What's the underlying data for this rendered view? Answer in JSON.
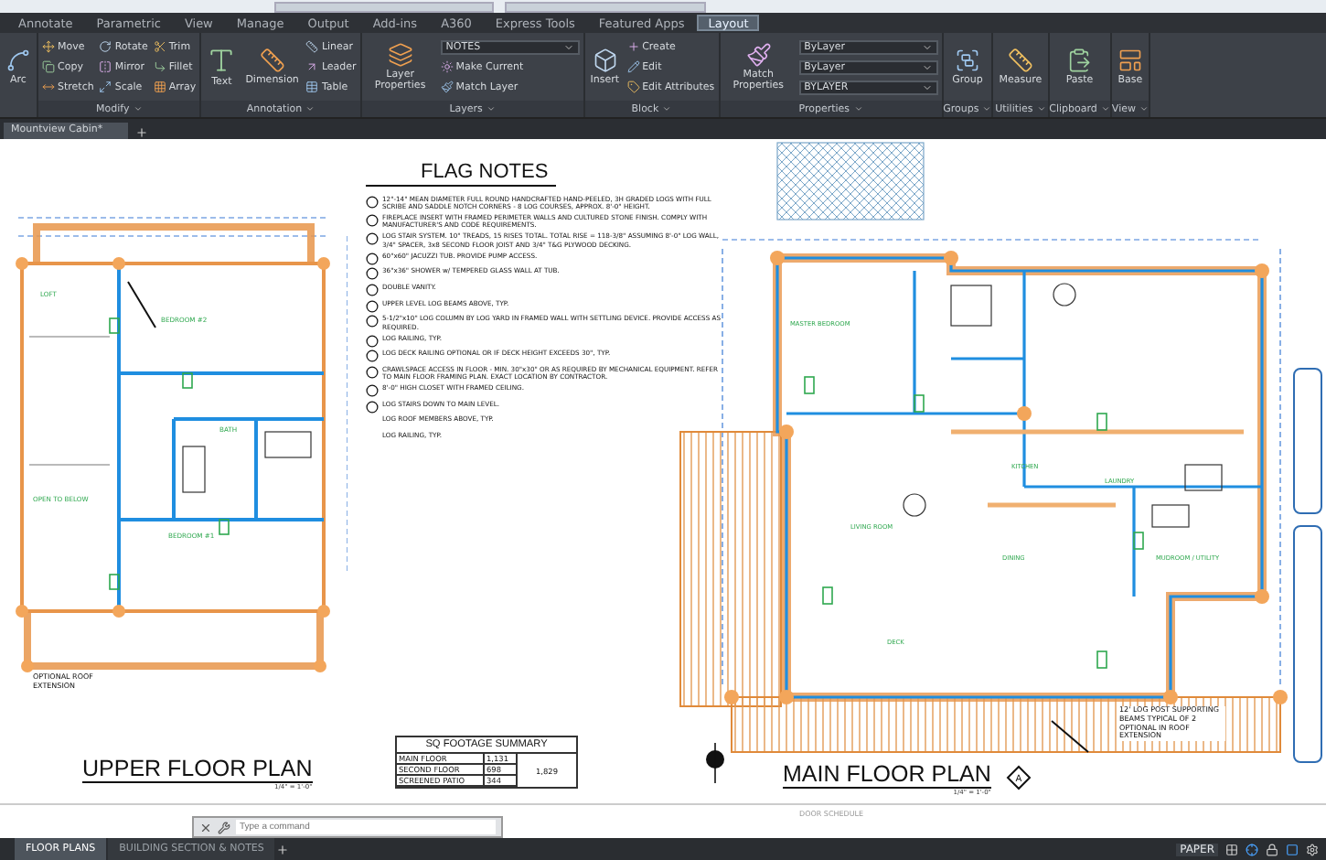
{
  "ribbon_tabs": [
    {
      "label": "Annotate",
      "selected": false
    },
    {
      "label": "Parametric",
      "selected": false
    },
    {
      "label": "View",
      "selected": false
    },
    {
      "label": "Manage",
      "selected": false
    },
    {
      "label": "Output",
      "selected": false
    },
    {
      "label": "Add-ins",
      "selected": false
    },
    {
      "label": "A360",
      "selected": false
    },
    {
      "label": "Express Tools",
      "selected": false
    },
    {
      "label": "Featured Apps",
      "selected": false
    },
    {
      "label": "Layout",
      "selected": true
    }
  ],
  "ribbon_panels": [
    {
      "items": [
        {
          "kind": "large",
          "label": "Arc"
        }
      ]
    },
    {
      "label": "Modify",
      "items": [
        {
          "kind": "small",
          "label": "Move"
        },
        {
          "kind": "small",
          "label": "Copy"
        },
        {
          "kind": "small",
          "label": "Stretch"
        },
        {
          "kind": "small",
          "label": "Rotate"
        },
        {
          "kind": "small",
          "label": "Mirror"
        },
        {
          "kind": "small",
          "label": "Scale"
        },
        {
          "kind": "small",
          "label": "Trim"
        },
        {
          "kind": "small",
          "label": "Fillet"
        },
        {
          "kind": "small",
          "label": "Array"
        }
      ]
    },
    {
      "label": "Annotation",
      "items": [
        {
          "kind": "large",
          "label": "Text"
        },
        {
          "kind": "large",
          "label": "Dimension"
        },
        {
          "kind": "small",
          "label": "Linear"
        },
        {
          "kind": "small",
          "label": "Leader"
        },
        {
          "kind": "small",
          "label": "Table"
        }
      ]
    },
    {
      "label": "Layers",
      "items": [
        {
          "kind": "large",
          "label": "Layer Properties"
        },
        {
          "kind": "dropdown",
          "label": "NOTES"
        },
        {
          "kind": "small",
          "label": "Make Current"
        },
        {
          "kind": "small",
          "label": "Match Layer"
        }
      ]
    },
    {
      "label": "Block",
      "items": [
        {
          "kind": "large",
          "label": "Insert"
        },
        {
          "kind": "small",
          "label": "Create"
        },
        {
          "kind": "small",
          "label": "Edit"
        },
        {
          "kind": "small",
          "label": "Edit Attributes"
        }
      ]
    },
    {
      "label": "Properties",
      "items": [
        {
          "kind": "large",
          "label": "Match Properties"
        },
        {
          "kind": "dropdown",
          "label": "ByLayer"
        },
        {
          "kind": "dropdown",
          "label": "ByLayer"
        },
        {
          "kind": "dropdown",
          "label": "BYLAYER"
        }
      ]
    },
    {
      "label": "Groups",
      "items": [
        {
          "kind": "large",
          "label": "Group"
        }
      ]
    },
    {
      "label": "Utilities",
      "items": [
        {
          "kind": "large",
          "label": "Measure"
        }
      ]
    },
    {
      "label": "Clipboard",
      "items": [
        {
          "kind": "large",
          "label": "Paste"
        }
      ]
    },
    {
      "label": "View",
      "items": [
        {
          "kind": "large",
          "label": "Base"
        }
      ]
    }
  ],
  "document_tabs": [
    {
      "label": "Mountview Cabin*",
      "selected": true
    }
  ],
  "upper_plan": {
    "rooms": [
      "LOFT",
      "BEDROOM #2",
      "BATH",
      "OPEN TO BELOW",
      "BEDROOM #1"
    ],
    "note": "OPTIONAL ROOF EXTENSION",
    "title": "UPPER FLOOR PLAN",
    "scale": "1/4\" = 1'-0\""
  },
  "flag_notes": {
    "title": "FLAG NOTES",
    "items": [
      {
        "text": "12\"-14\" MEAN DIAMETER FULL ROUND HANDCRAFTED HAND-PEELED, 3H GRADED LOGS WITH FULL SCRIBE AND SADDLE NOTCH CORNERS - 8 LOG COURSES, APPROX. 8'-0\" HEIGHT.",
        "marked": true
      },
      {
        "text": "FIREPLACE INSERT WITH FRAMED PERIMETER WALLS AND CULTURED STONE FINISH. COMPLY WITH MANUFACTURER'S AND CODE REQUIREMENTS.",
        "marked": true
      },
      {
        "text": "LOG STAIR SYSTEM. 10\" TREADS, 15 RISES TOTAL. TOTAL RISE = 118-3/8\" ASSUMING 8'-0\" LOG WALL, 3/4\" SPACER, 3x8 SECOND FLOOR JOIST AND 3/4\" T&G PLYWOOD DECKING.",
        "marked": true
      },
      {
        "text": "60\"x60\" JACUZZI TUB. PROVIDE PUMP ACCESS.",
        "marked": true
      },
      {
        "text": "36\"x36\" SHOWER w/ TEMPERED GLASS WALL AT TUB.",
        "marked": true
      },
      {
        "text": "DOUBLE VANITY.",
        "marked": true
      },
      {
        "text": "UPPER LEVEL LOG BEAMS ABOVE, TYP.",
        "marked": true
      },
      {
        "text": "5-1/2\"x10\" LOG COLUMN BY LOG YARD IN FRAMED WALL WITH SETTLING DEVICE. PROVIDE ACCESS AS REQUIRED.",
        "marked": true
      },
      {
        "text": "LOG RAILING, TYP.",
        "marked": true
      },
      {
        "text": "LOG DECK RAILING OPTIONAL OR IF DECK HEIGHT EXCEEDS 30\", TYP.",
        "marked": true
      },
      {
        "text": "CRAWLSPACE ACCESS IN FLOOR - MIN. 30\"x30\" OR AS REQUIRED BY MECHANICAL EQUIPMENT. REFER TO MAIN FLOOR FRAMING PLAN. EXACT LOCATION BY CONTRACTOR.",
        "marked": true
      },
      {
        "text": "8'-0\" HIGH CLOSET WITH FRAMED CEILING.",
        "marked": true
      },
      {
        "text": "LOG STAIRS DOWN TO MAIN LEVEL.",
        "marked": true
      },
      {
        "text": "LOG ROOF MEMBERS ABOVE, TYP.",
        "marked": false
      },
      {
        "text": "LOG RAILING, TYP.",
        "marked": false
      }
    ]
  },
  "sq_footage": {
    "title": "SQ FOOTAGE SUMMARY",
    "rows": [
      {
        "label": "MAIN FLOOR",
        "value": "1,131"
      },
      {
        "label": "SECOND FLOOR",
        "value": "698"
      },
      {
        "label": "SCREENED PATIO",
        "value": "344"
      }
    ],
    "total": "1,829"
  },
  "main_plan": {
    "rooms": [
      "MASTER BEDROOM",
      "KITCHEN",
      "LIVING ROOM",
      "DINING",
      "DECK",
      "LAUNDRY",
      "MUDROOM / UTILITY"
    ],
    "note": "12' LOG POST SUPPORTING BEAMS TYPICAL OF 2 OPTIONAL IN ROOF EXTENSION",
    "section_marker": "A",
    "title": "MAIN FLOOR PLAN",
    "scale": "1/4\" = 1'-0\""
  },
  "door_schedule": "DOOR SCHEDULE",
  "command_line": {
    "placeholder": "Type a command"
  },
  "layout_tabs": [
    {
      "label": "FLOOR PLANS",
      "selected": true
    },
    {
      "label": "BUILDING SECTION & NOTES",
      "selected": false
    }
  ],
  "status_bar": {
    "space": "PAPER"
  }
}
